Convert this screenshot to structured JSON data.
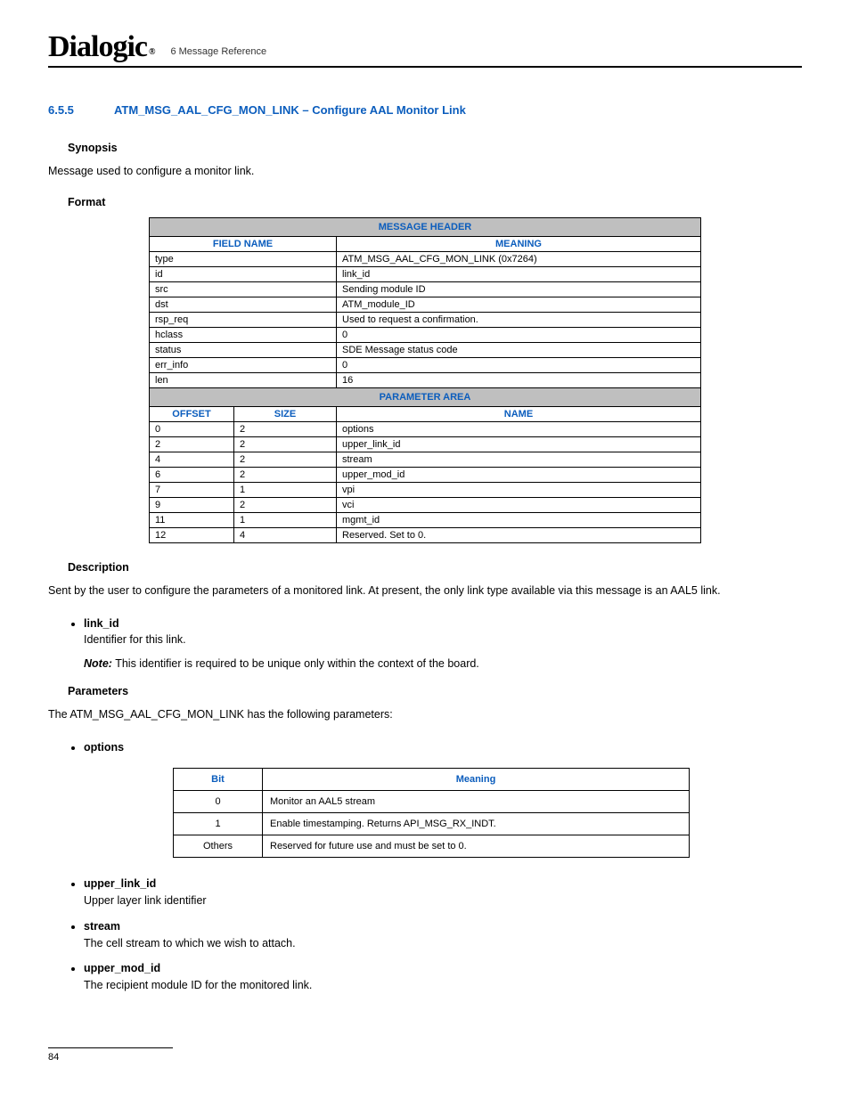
{
  "header": {
    "logo_text": "Dialogic",
    "logo_reg": "®",
    "chapter": "6 Message Reference"
  },
  "section": {
    "number": "6.5.5",
    "title": "ATM_MSG_AAL_CFG_MON_LINK – Configure AAL Monitor Link"
  },
  "synopsis": {
    "heading": "Synopsis",
    "text": "Message used to configure a monitor link."
  },
  "format": {
    "heading": "Format",
    "msg_header_band": "MESSAGE HEADER",
    "field_name_col": "FIELD NAME",
    "meaning_col": "MEANING",
    "header_rows": [
      {
        "field": "type",
        "meaning": "ATM_MSG_AAL_CFG_MON_LINK (0x7264)"
      },
      {
        "field": "id",
        "meaning": "link_id"
      },
      {
        "field": "src",
        "meaning": "Sending module ID"
      },
      {
        "field": "dst",
        "meaning": "ATM_module_ID"
      },
      {
        "field": "rsp_req",
        "meaning": "Used to request a confirmation."
      },
      {
        "field": "hclass",
        "meaning": "0"
      },
      {
        "field": "status",
        "meaning": "SDE Message status code"
      },
      {
        "field": "err_info",
        "meaning": "0"
      },
      {
        "field": "len",
        "meaning": "16"
      }
    ],
    "param_area_band": "PARAMETER AREA",
    "offset_col": "OFFSET",
    "size_col": "SIZE",
    "name_col": "NAME",
    "param_rows": [
      {
        "offset": "0",
        "size": "2",
        "name": "options"
      },
      {
        "offset": "2",
        "size": "2",
        "name": "upper_link_id"
      },
      {
        "offset": "4",
        "size": "2",
        "name": "stream"
      },
      {
        "offset": "6",
        "size": "2",
        "name": "upper_mod_id"
      },
      {
        "offset": "7",
        "size": "1",
        "name": "vpi"
      },
      {
        "offset": "9",
        "size": "2",
        "name": "vci"
      },
      {
        "offset": "11",
        "size": "1",
        "name": "mgmt_id"
      },
      {
        "offset": "12",
        "size": "4",
        "name": "Reserved. Set to 0."
      }
    ]
  },
  "description": {
    "heading": "Description",
    "text": "Sent by the user to configure the parameters of a monitored link. At present, the only link type available via this message is an AAL5 link.",
    "link_id_head": "link_id",
    "link_id_text": "Identifier for this link.",
    "note_label": "Note:",
    "note_text": "This identifier is required to be unique only within the context of the board."
  },
  "parameters": {
    "heading": "Parameters",
    "intro": "The ATM_MSG_AAL_CFG_MON_LINK has the following parameters:",
    "options_head": "options",
    "bit_col": "Bit",
    "meaning_col": "Meaning",
    "option_rows": [
      {
        "bit": "0",
        "meaning": "Monitor an AAL5 stream"
      },
      {
        "bit": "1",
        "meaning": "Enable timestamping. Returns API_MSG_RX_INDT."
      },
      {
        "bit": "Others",
        "meaning": "Reserved for future use and must be set to 0."
      }
    ],
    "upper_link_id_head": "upper_link_id",
    "upper_link_id_text": "Upper layer link identifier",
    "stream_head": "stream",
    "stream_text": "The cell stream to which we wish to attach.",
    "upper_mod_id_head": "upper_mod_id",
    "upper_mod_id_text": "The recipient module ID for the monitored link."
  },
  "page_number": "84"
}
